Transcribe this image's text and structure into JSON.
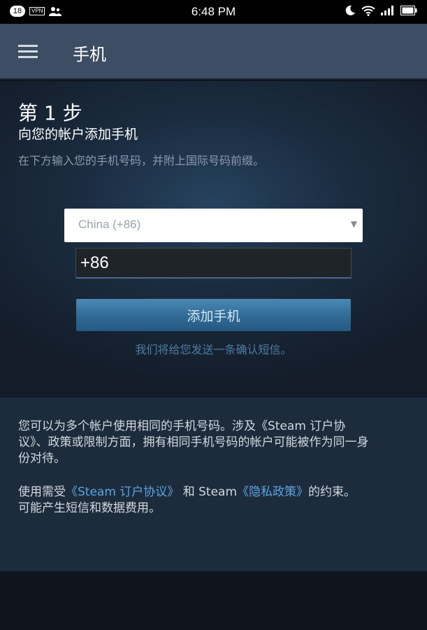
{
  "status_bar": {
    "notification_count": "18",
    "vpn_label": "VPN",
    "time": "6:48 PM",
    "icons": [
      "user-icon",
      "moon-icon",
      "wifi-icon",
      "signal-icon",
      "battery-icon"
    ]
  },
  "app_bar": {
    "title": "手机",
    "menu_icon": "hamburger-menu-icon"
  },
  "step": {
    "title": "第 1 步",
    "subtitle": "向您的帐户添加手机",
    "hint": "在下方输入您的手机号码，并附上国际号码前缀。"
  },
  "form": {
    "country_selected": "China (+86)",
    "phone_value": "+86",
    "add_button_label": "添加手机",
    "sms_note": "我们将给您发送一条确认短信。"
  },
  "info": {
    "paragraph1": "您可以为多个帐户使用相同的手机号码。涉及《Steam 订户协议》、政策或限制方面，拥有相同手机号码的帐户可能被作为同一身份对待。",
    "terms_prefix": "使用需受",
    "ssa_link": "《Steam 订户协议》",
    "terms_middle": "和 Steam",
    "privacy_link": "《隐私政策》",
    "terms_suffix": "的约束。",
    "charges_note": "可能产生短信和数据费用。"
  },
  "colors": {
    "app_bar": "#3d4d63",
    "button": "#2f6a95",
    "link": "#5aa5e2",
    "info_panel": "#1d2c3c"
  }
}
